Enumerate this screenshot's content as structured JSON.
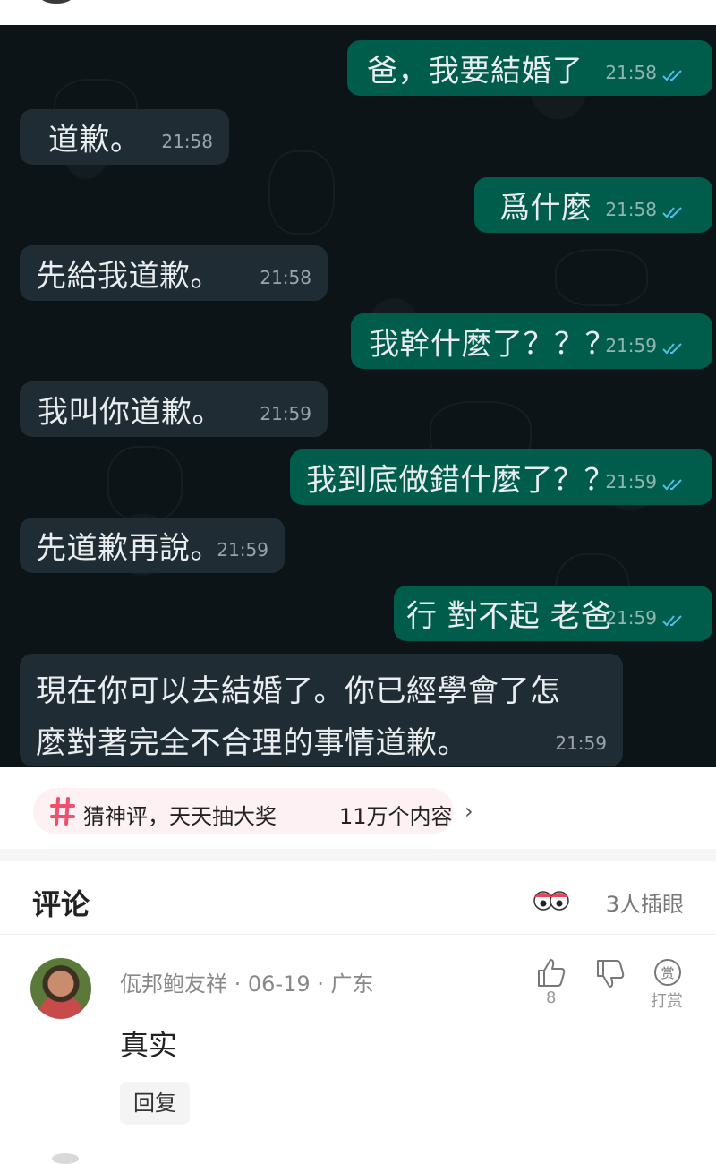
{
  "chat": {
    "messages": [
      {
        "side": "out",
        "text": "爸，我要結婚了",
        "time": "21:58",
        "read": true
      },
      {
        "side": "in",
        "text": "道歉。",
        "time": "21:58"
      },
      {
        "side": "out",
        "text": "爲什麼",
        "time": "21:58",
        "read": true
      },
      {
        "side": "in",
        "text": "先給我道歉。",
        "time": "21:58"
      },
      {
        "side": "out",
        "text": "我幹什麼了？？？",
        "time": "21:59",
        "read": true
      },
      {
        "side": "in",
        "text": "我叫你道歉。",
        "time": "21:59"
      },
      {
        "side": "out",
        "text": "我到底做錯什麼了？？",
        "time": "21:59",
        "read": true
      },
      {
        "side": "in",
        "text": "先道歉再說。",
        "time": "21:59"
      },
      {
        "side": "out",
        "text": "行 對不起 老爸",
        "time": "21:59",
        "read": true
      },
      {
        "side": "in",
        "lines": [
          "現在你可以去結婚了。你已經學會了怎",
          "麼對著完全不合理的事情道歉。"
        ],
        "time": "21:59"
      }
    ],
    "colors": {
      "background": "#0c1418",
      "outgoing": "#005c4b",
      "incoming": "#1f2c33",
      "tick": "#53bdeb"
    }
  },
  "topic": {
    "text": "猜神评，天天抽大奖",
    "count": "11万个内容",
    "icon": "hashtag-icon",
    "accent": "#f0506e"
  },
  "comments": {
    "title": "评论",
    "watchers": "3人插眼",
    "items": [
      {
        "author": "佤邦鲍友祥",
        "date": "06-19",
        "location": "广东",
        "meta": "佤邦鲍友祥 · 06-19 · 广东",
        "text": "真实",
        "likes": "8",
        "tip_label": "打赏",
        "reply_label": "回复"
      }
    ]
  }
}
